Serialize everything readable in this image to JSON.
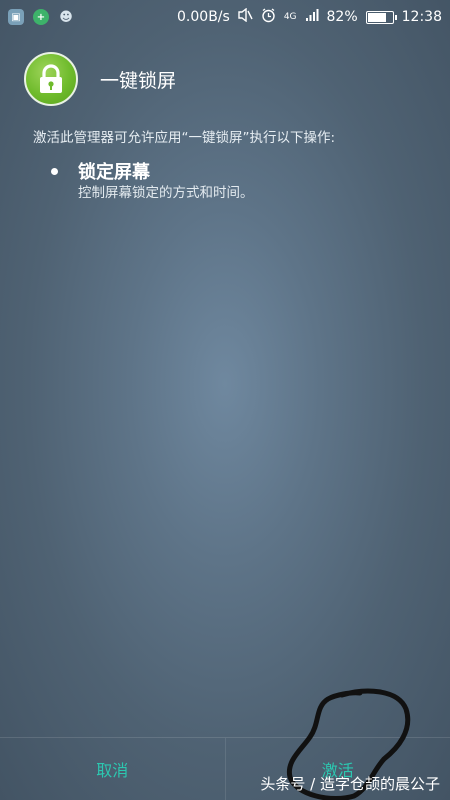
{
  "status_bar": {
    "net_speed": "0.00B/s",
    "battery_percent": "82%",
    "battery_level": 0.82,
    "time": "12:38",
    "signal_label": "4G",
    "left_icons": [
      "gallery-icon",
      "add-icon",
      "robot-icon"
    ],
    "right_icons": [
      "mute-icon",
      "alarm-icon",
      "signal-icon",
      "battery-icon"
    ]
  },
  "app": {
    "title": "一键锁屏",
    "icon": "lock-icon",
    "icon_color": "#6fbb2c"
  },
  "description": "激活此管理器可允许应用“一键锁屏”执行以下操作:",
  "permissions": [
    {
      "title": "锁定屏幕",
      "desc": "控制屏幕锁定的方式和时间。"
    }
  ],
  "buttons": {
    "cancel": "取消",
    "activate": "激活",
    "accent": "#2cc7b0"
  },
  "watermark": "头条号 / 造字仓颉的晨公子"
}
